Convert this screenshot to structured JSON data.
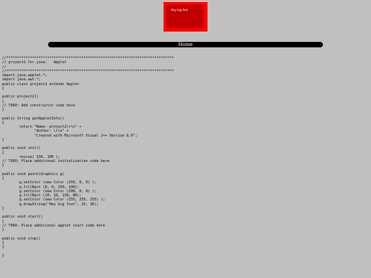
{
  "applet": {
    "text": "Hey big foot",
    "background_color": "#ff0000",
    "rect_color": "#c00000",
    "text_color": "#ffffff"
  },
  "nav": {
    "home_label": "Home",
    "bar_color": "#000000"
  },
  "page": {
    "background_color": "#c0c0c0"
  },
  "source_code": "//******************************************************************************\n// project2.for.java:   Applet\n//\n//******************************************************************************\nimport java.applet.*;\nimport java.awt.*;\npublic class project2 extends Applet\n{\n\npublic project2()\n{\n// TODO: Add constructor code here\n}\n\npublic String getAppletInfo()\n{\n        return \"Name: project2\\r\\n\" +\n               \"Author: \\r\\n\" +\n               \"Created with Microsoft Visual J++ Version 6.0\";\n}\n\npublic void init()\n{\n        resize( 150, 100 );\n// TODO: Place additional initialization code here\n}\n\npublic void paint(Graphics g)\n{\n        g.setColor (new Color (255, 0, 0) );\n        g.fillRect (0, 0, 150, 100);\n        g.setColor (new Color (200, 0, 0) );\n        g.fillRect (10, 10, 130, 80);\n        g.setColor (new Color (255, 255, 255) );\n        g.drawString(\"Hey big foot\", 25, 30);\n}\n\npublic void start()\n{\n// TODO: Place additional applet start code here\n}\n\npublic void stop()\n{\n}\n\n}"
}
